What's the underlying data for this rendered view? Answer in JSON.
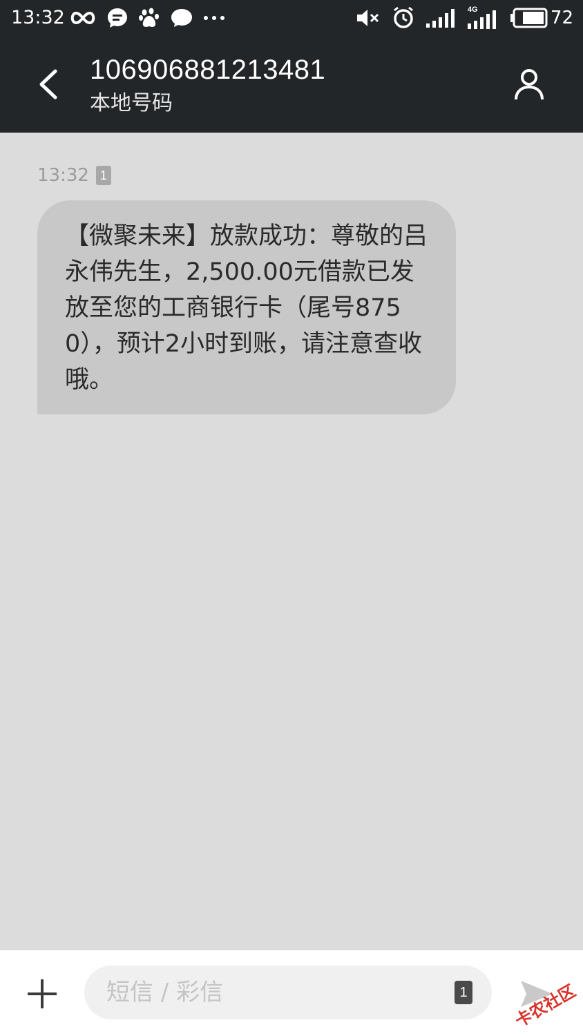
{
  "status_bar": {
    "time": "13:32",
    "network_label": "4G",
    "battery_level": "72",
    "left_icons": [
      "infinity-icon",
      "chat-bubble-icon",
      "baidu-paw-icon",
      "message-icon",
      "more-dots-icon"
    ],
    "right_icons": [
      "mute-icon",
      "alarm-icon",
      "signal-icon",
      "signal-4g-icon",
      "battery-icon"
    ]
  },
  "header": {
    "contact_number": "106906881213481",
    "contact_subtitle": "本地号码"
  },
  "conversation": {
    "messages": [
      {
        "time": "13:32",
        "sim_slot": "1",
        "text": "【微聚未来】放款成功：尊敬的吕永伟先生，2,500.00元借款已发放至您的工商银行卡（尾号8750），预计2小时到账，请注意查收哦。"
      }
    ]
  },
  "compose": {
    "placeholder": "短信 / 彩信",
    "sim_slot": "1"
  },
  "watermark": {
    "text": "卡农社区"
  },
  "colors": {
    "header_bg": "#232628",
    "conversation_bg": "#dcdcdc",
    "bubble_bg": "#c8c8c8",
    "compose_bg": "#ffffff",
    "watermark": "#d9342b"
  }
}
